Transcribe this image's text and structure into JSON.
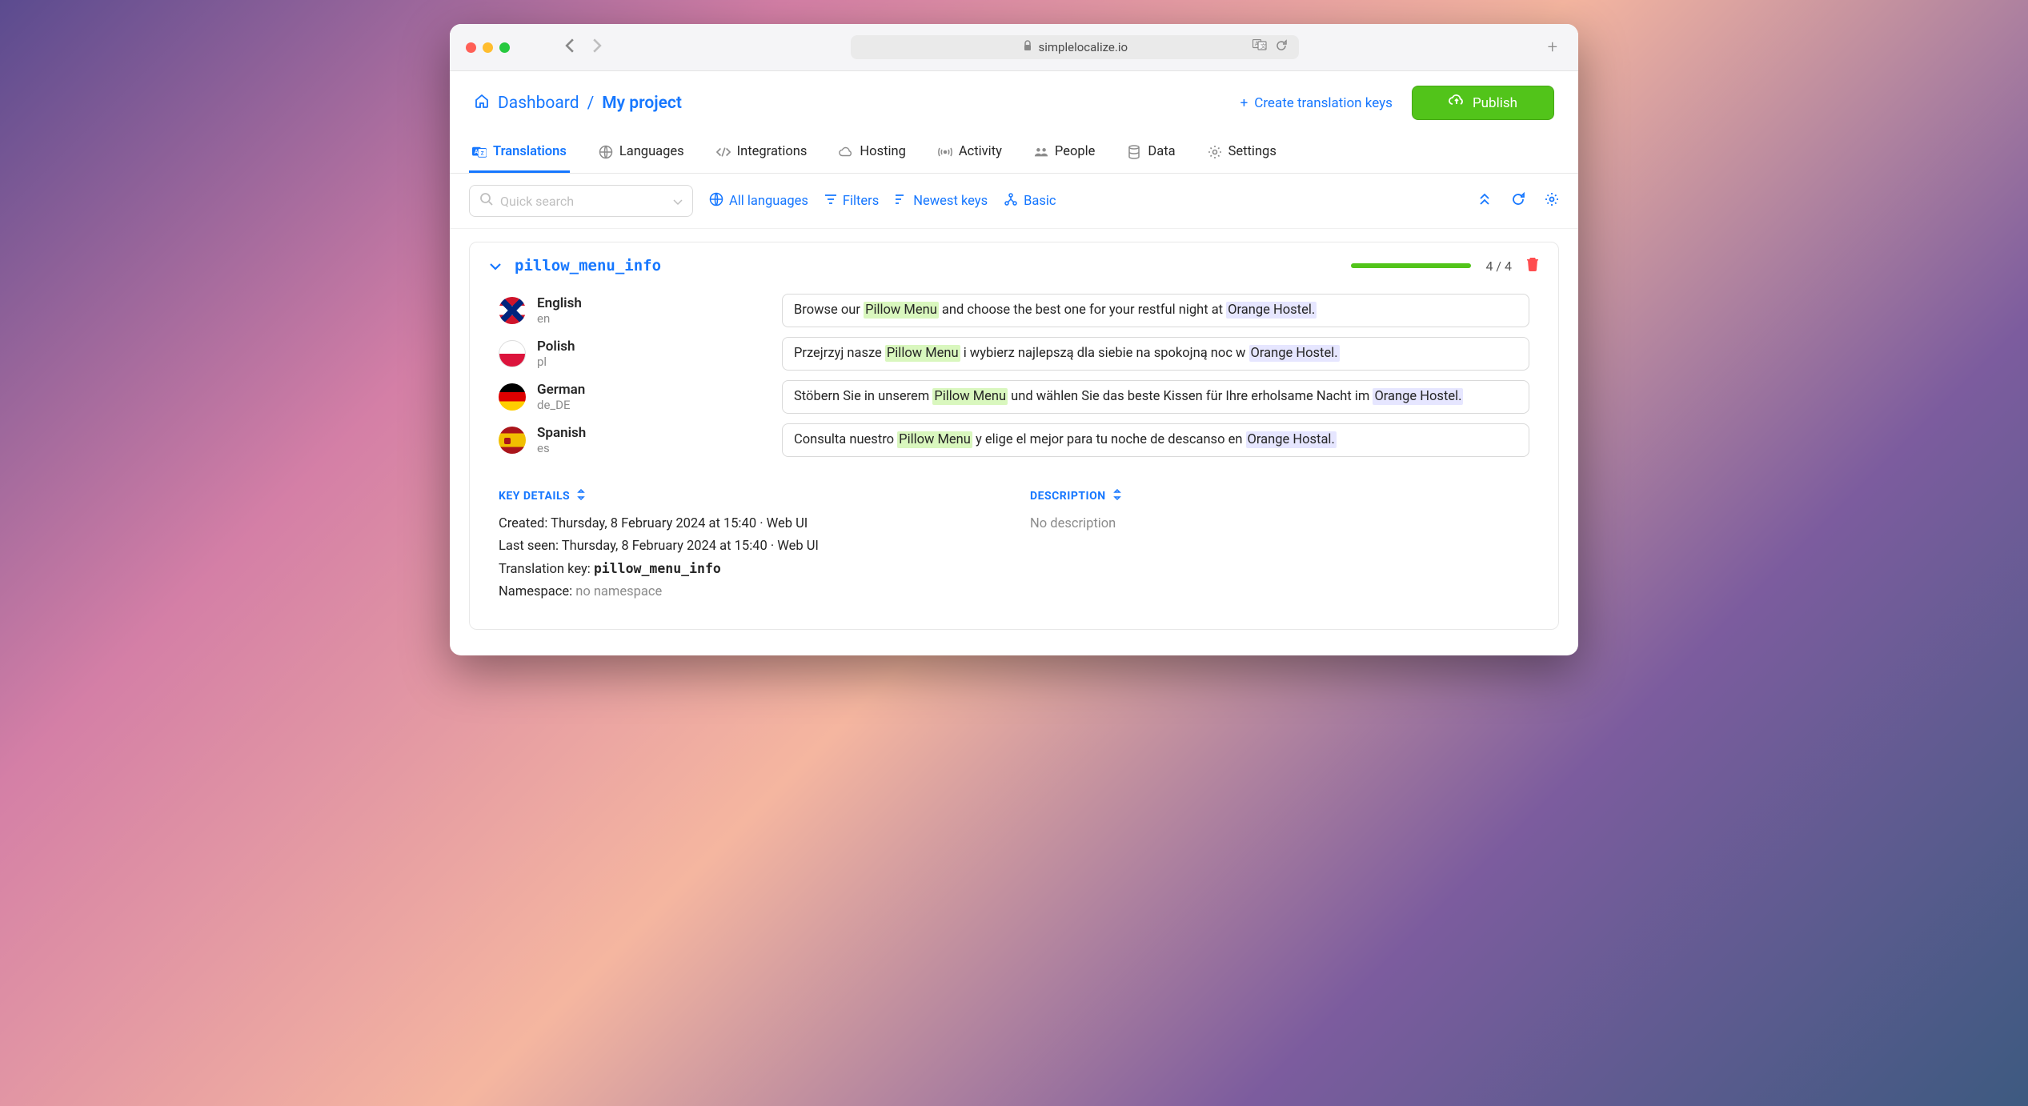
{
  "browser": {
    "url": "simplelocalize.io"
  },
  "breadcrumb": {
    "home": "Dashboard",
    "current": "My project"
  },
  "header_actions": {
    "create_label": "Create translation keys",
    "publish_label": "Publish"
  },
  "tabs": [
    {
      "label": "Translations",
      "icon": "translate-icon"
    },
    {
      "label": "Languages",
      "icon": "globe-icon"
    },
    {
      "label": "Integrations",
      "icon": "code-icon"
    },
    {
      "label": "Hosting",
      "icon": "cloud-icon"
    },
    {
      "label": "Activity",
      "icon": "signal-icon"
    },
    {
      "label": "People",
      "icon": "people-icon"
    },
    {
      "label": "Data",
      "icon": "database-icon"
    },
    {
      "label": "Settings",
      "icon": "gear-icon"
    }
  ],
  "toolbar": {
    "search_placeholder": "Quick search",
    "all_languages": "All languages",
    "filters": "Filters",
    "newest": "Newest keys",
    "basic": "Basic"
  },
  "key": {
    "name": "pillow_menu_info",
    "progress_text": "4 / 4"
  },
  "translations": [
    {
      "lang_name": "English",
      "lang_code": "en",
      "flag": "flag-en",
      "segments": [
        {
          "t": "Browse our ",
          "c": ""
        },
        {
          "t": "Pillow Menu",
          "c": "green"
        },
        {
          "t": " and choose the best one for your restful night at ",
          "c": ""
        },
        {
          "t": "Orange Hostel.",
          "c": "purple"
        }
      ]
    },
    {
      "lang_name": "Polish",
      "lang_code": "pl",
      "flag": "flag-pl",
      "segments": [
        {
          "t": "Przejrzyj nasze ",
          "c": ""
        },
        {
          "t": "Pillow Menu",
          "c": "green"
        },
        {
          "t": " i wybierz najlepszą dla siebie na spokojną noc w ",
          "c": ""
        },
        {
          "t": "Orange Hostel.",
          "c": "purple"
        }
      ]
    },
    {
      "lang_name": "German",
      "lang_code": "de_DE",
      "flag": "flag-de",
      "segments": [
        {
          "t": "Stöbern Sie in unserem ",
          "c": ""
        },
        {
          "t": "Pillow Menu",
          "c": "green"
        },
        {
          "t": " und wählen Sie das beste Kissen für Ihre erholsame Nacht im ",
          "c": ""
        },
        {
          "t": "Orange Hostel.",
          "c": "purple"
        }
      ]
    },
    {
      "lang_name": "Spanish",
      "lang_code": "es",
      "flag": "flag-es",
      "segments": [
        {
          "t": "Consulta nuestro ",
          "c": ""
        },
        {
          "t": "Pillow Menu",
          "c": "green"
        },
        {
          "t": " y elige el mejor para tu noche de descanso en ",
          "c": ""
        },
        {
          "t": "Orange Hostal.",
          "c": "purple"
        }
      ]
    }
  ],
  "details": {
    "title": "KEY DETAILS",
    "created_label": "Created:",
    "created_value": "Thursday, 8 February 2024 at 15:40",
    "created_source": "Web UI",
    "lastseen_label": "Last seen:",
    "lastseen_value": "Thursday, 8 February 2024 at 15:40",
    "lastseen_source": "Web UI",
    "key_label": "Translation key:",
    "key_value": "pillow_menu_info",
    "ns_label": "Namespace:",
    "ns_value": "no namespace"
  },
  "description": {
    "title": "DESCRIPTION",
    "empty": "No description"
  }
}
